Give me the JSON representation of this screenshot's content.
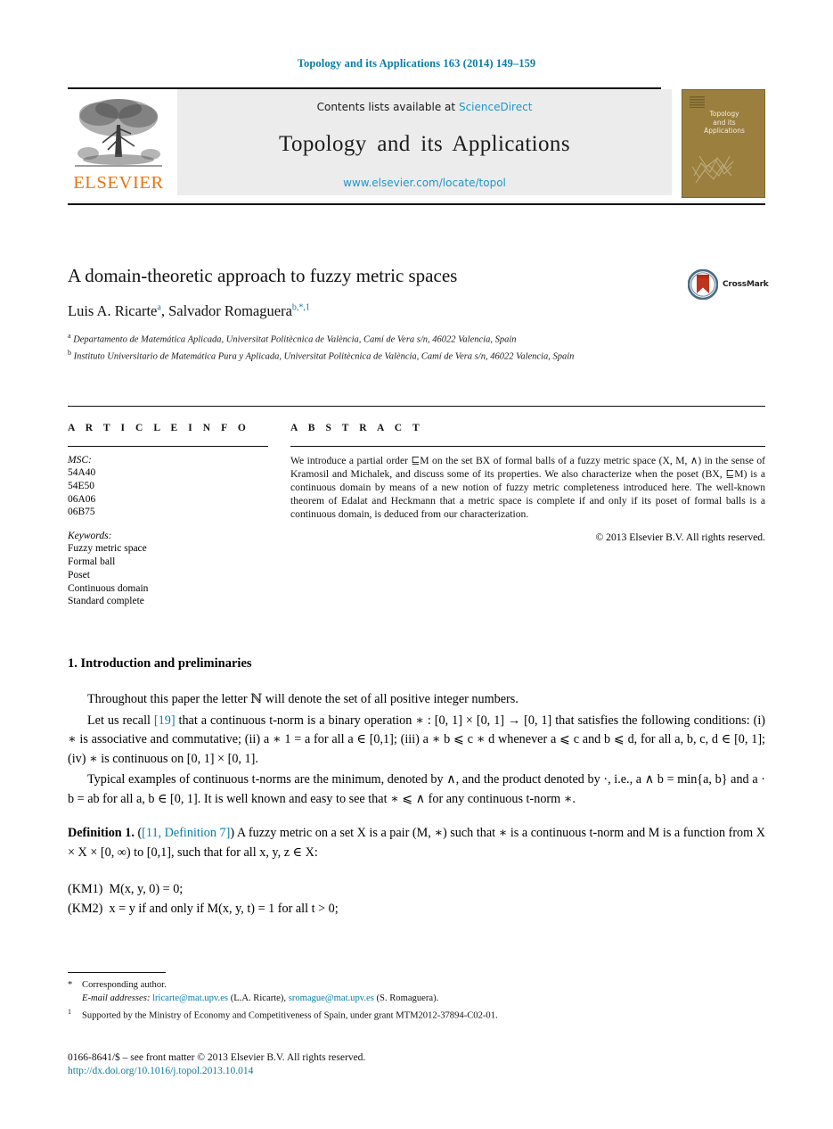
{
  "running_head": "Topology and its Applications 163 (2014) 149–159",
  "masthead": {
    "contents_text": "Contents lists available at",
    "contents_link": "ScienceDirect",
    "journal_name": "Topology and its Applications",
    "journal_url": "www.elsevier.com/locate/topol",
    "publisher": "ELSEVIER",
    "cover_title_line1": "Topology",
    "cover_title_line2": "and its",
    "cover_title_line3": "Applications"
  },
  "crossmark": {
    "label": "CrossMark"
  },
  "article": {
    "title": "A domain-theoretic approach to fuzzy metric spaces",
    "authors_part1": "Luis A. Ricarte",
    "authors_sup1": "a",
    "authors_part2": ", Salvador Romaguera",
    "authors_sup2": "b,*,1",
    "affiliation_a_marker": "a",
    "affiliation_a": "Departamento de Matemática Aplicada, Universitat Politècnica de València, Camí de Vera s/n, 46022 Valencia, Spain",
    "affiliation_b_marker": "b",
    "affiliation_b": "Instituto Universitario de Matemática Pura y Aplicada, Universitat Politècnica de València, Camí de Vera s/n, 46022 Valencia, Spain"
  },
  "article_info": {
    "heading": "A R T I C L E   I N F O",
    "msc_title": "MSC:",
    "msc_codes": [
      "54A40",
      "54E50",
      "06A06",
      "06B75"
    ],
    "keywords_title": "Keywords:",
    "keywords": [
      "Fuzzy metric space",
      "Formal ball",
      "Poset",
      "Continuous domain",
      "Standard complete"
    ]
  },
  "abstract": {
    "heading": "A B S T R A C T",
    "text": "We introduce a partial order ⊑M on the set BX of formal balls of a fuzzy metric space (X, M, ∧) in the sense of Kramosil and Michalek, and discuss some of its properties. We also characterize when the poset (BX, ⊑M) is a continuous domain by means of a new notion of fuzzy metric completeness introduced here. The well-known theorem of Edalat and Heckmann that a metric space is complete if and only if its poset of formal balls is a continuous domain, is deduced from our characterization.",
    "copyright": "© 2013 Elsevier B.V. All rights reserved."
  },
  "body": {
    "section_title": "1. Introduction and preliminaries",
    "para1": "Throughout this paper the letter ℕ will denote the set of all positive integer numbers.",
    "para2_pre": "Let us recall ",
    "para2_ref": "[19]",
    "para2_post": " that a continuous t-norm is a binary operation ∗ : [0, 1] × [0, 1] → [0, 1] that satisfies the following conditions: (i) ∗ is associative and commutative; (ii) a ∗ 1 = a for all a ∈ [0,1]; (iii) a ∗ b ⩽ c ∗ d whenever a ⩽ c and b ⩽ d, for all a, b, c, d ∈ [0, 1]; (iv) ∗ is continuous on [0, 1] × [0, 1].",
    "para3": "Typical examples of continuous t-norms are the minimum, denoted by ∧, and the product denoted by ·, i.e., a ∧ b = min{a, b} and a · b = ab for all a, b ∈ [0, 1]. It is well known and easy to see that ∗ ⩽ ∧ for any continuous t-norm ∗.",
    "definition_label": "Definition 1.",
    "definition_ref": "[11, Definition 7]",
    "definition_text": ") A fuzzy metric on a set X is a pair (M, ∗) such that ∗ is a continuous t-norm and M is a function from X × X × [0, ∞) to [0,1], such that for all x, y, z ∈ X:",
    "axiom1_label": "(KM1)",
    "axiom1_text": "M(x, y, 0) = 0;",
    "axiom2_label": "(KM2)",
    "axiom2_text": "x = y if and only if M(x, y, t) = 1 for all t > 0;"
  },
  "footnotes": {
    "corresponding_marker": "*",
    "corresponding_text": "Corresponding author.",
    "email_label": "E-mail addresses:",
    "email1": "lricarte@mat.upv.es",
    "email1_name": "(L.A. Ricarte),",
    "email2": "sromague@mat.upv.es",
    "email2_name": "(S. Romaguera).",
    "grant_marker": "1",
    "grant_text": "Supported by the Ministry of Economy and Competitiveness of Spain, under grant MTM2012-37894-C02-01."
  },
  "footer": {
    "issn_line": "0166-8641/$ – see front matter  © 2013 Elsevier B.V. All rights reserved.",
    "doi": "http://dx.doi.org/10.1016/j.topol.2013.10.014"
  },
  "colors": {
    "link_blue": "#0b7ba8",
    "sciencedirect_blue": "#2196c9",
    "elsevier_orange": "#e87511",
    "cover_tan": "#9a7f3f",
    "crossmark_red": "#c0341d"
  }
}
